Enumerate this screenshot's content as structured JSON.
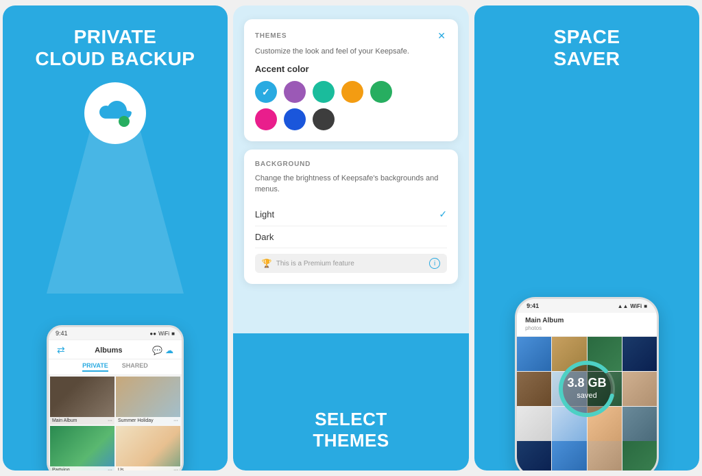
{
  "panel1": {
    "title_line1": "PRIVATE",
    "title_line2": "CLOUD BACKUP",
    "phone": {
      "time": "9:41",
      "nav_title": "Albums",
      "tab_private": "PRIVATE",
      "tab_shared": "SHARED",
      "albums": [
        {
          "name": "Main Album",
          "photo_class": "photo-1"
        },
        {
          "name": "Summer Holiday",
          "photo_class": "photo-2"
        },
        {
          "name": "Partying",
          "photo_class": "photo-3"
        },
        {
          "name": "Us",
          "photo_class": "photo-4"
        }
      ]
    }
  },
  "panel2": {
    "themes_card": {
      "title": "THEMES",
      "description": "Customize the look and feel of your Keepsafe.",
      "accent_label": "Accent color",
      "colors_row1": [
        {
          "color": "#29aae1",
          "selected": true
        },
        {
          "color": "#9b59b6",
          "selected": false
        },
        {
          "color": "#1abc9c",
          "selected": false
        },
        {
          "color": "#f39c12",
          "selected": false
        },
        {
          "color": "#27ae60",
          "selected": false
        }
      ],
      "colors_row2": [
        {
          "color": "#e91e8c",
          "selected": false
        },
        {
          "color": "#1a56db",
          "selected": false
        },
        {
          "color": "#3d3d3d",
          "selected": false
        }
      ]
    },
    "bg_card": {
      "title": "BACKGROUND",
      "description": "Change the brightness of Keepsafe's backgrounds and menus.",
      "options": [
        {
          "label": "Light",
          "selected": true
        },
        {
          "label": "Dark",
          "selected": false
        }
      ],
      "premium_text": "This is a Premium feature"
    },
    "bottom_label_line1": "SELECT",
    "bottom_label_line2": "THEMES"
  },
  "panel3": {
    "title_line1": "SPACE",
    "title_line2": "SAVER",
    "savings": {
      "value": "3.8",
      "unit": "GB",
      "label": "saved"
    },
    "phone": {
      "time": "9:41",
      "album_title": "Main Album"
    }
  }
}
